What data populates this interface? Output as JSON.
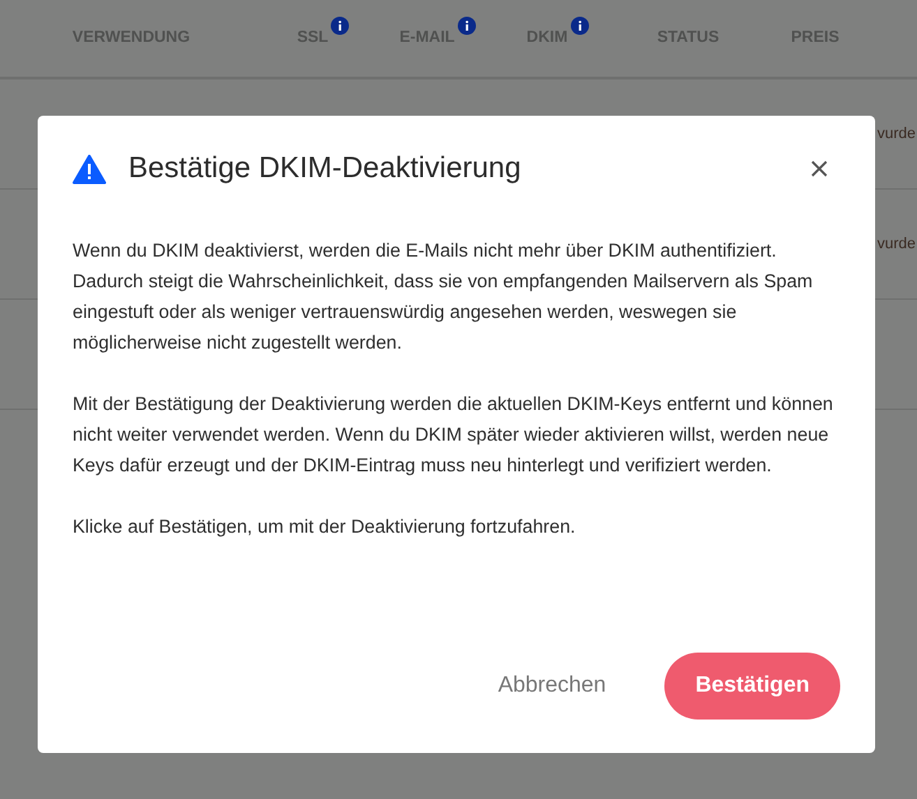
{
  "table": {
    "columns": [
      {
        "label": "VERWENDUNG",
        "kind": "plain"
      },
      {
        "label": "SSL",
        "kind": "info"
      },
      {
        "label": "E-MAIL",
        "kind": "info"
      },
      {
        "label": "DKIM",
        "kind": "info"
      },
      {
        "label": "STATUS",
        "kind": "plain"
      },
      {
        "label": "PREIS",
        "kind": "plain"
      }
    ],
    "rows": [
      {
        "column_7": "vurde"
      },
      {
        "column_7": "vurde"
      }
    ]
  },
  "dialog": {
    "title": "Bestätige DKIM-Deaktivierung",
    "paragraphs": [
      "Wenn du DKIM deaktivierst, werden die E-Mails nicht mehr über DKIM authentifiziert. Dadurch steigt die Wahrscheinlichkeit, dass sie von empfangenden Mailservern als Spam eingestuft oder als weniger vertrauenswürdig angesehen werden, weswegen sie möglicherweise nicht zugestellt werden.",
      "Mit der Bestätigung der Deaktivierung werden die aktuellen DKIM-Keys entfernt und können nicht weiter verwendet werden. Wenn du DKIM später wieder aktivieren willst, werden neue Keys dafür erzeugt und der DKIM-Eintrag muss neu hinterlegt und verifiziert werden.",
      "Klicke auf Bestätigen, um mit der Deaktivierung fortzufahren."
    ],
    "buttons": [
      {
        "label": "Abbrechen",
        "kind": "secondary"
      },
      {
        "label": "Bestätigen",
        "kind": "primary"
      }
    ]
  }
}
